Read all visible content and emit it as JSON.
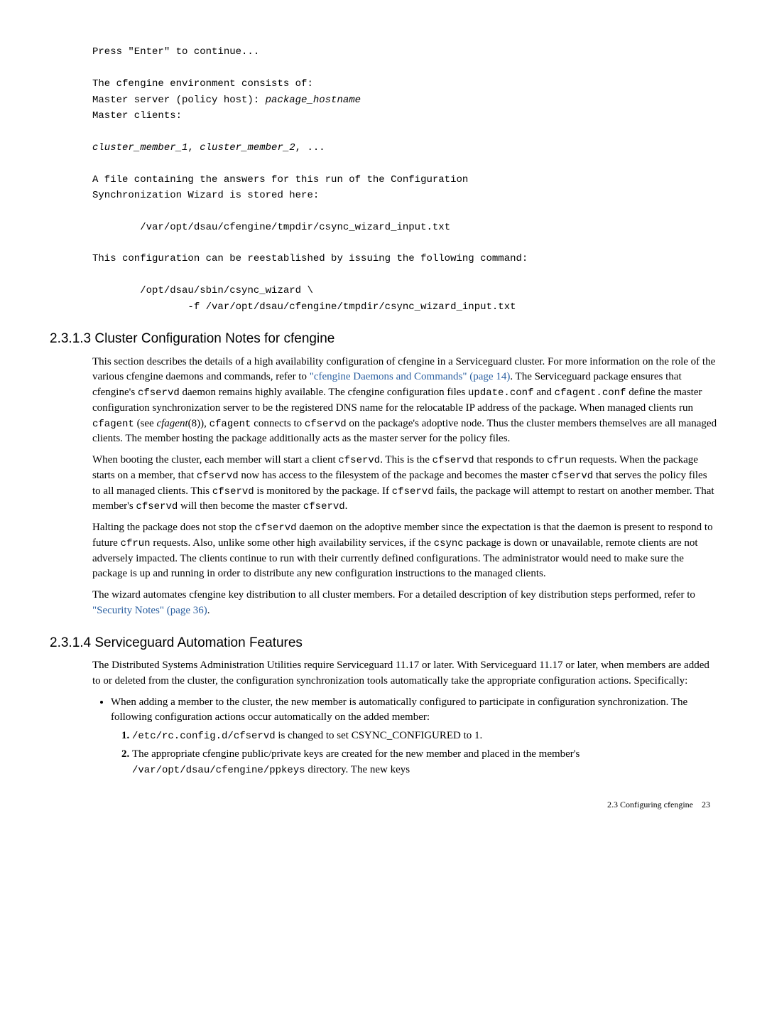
{
  "code": {
    "line1": "Press \"Enter\" to continue...",
    "line2": "The cfengine environment consists of:",
    "line3a": "Master server (policy host): ",
    "line3b": "package_hostname",
    "line4": "Master clients:",
    "line5a": "cluster_member_1",
    "line5comma1": ", ",
    "line5b": "cluster_member_2",
    "line5comma2": ", ...",
    "line6": "A file containing the answers for this run of the Configuration",
    "line7": "Synchronization Wizard is stored here:",
    "line8": "        /var/opt/dsau/cfengine/tmpdir/csync_wizard_input.txt",
    "line9": "This configuration can be reestablished by issuing the following command:",
    "line10": "        /opt/dsau/sbin/csync_wizard \\",
    "line11": "                -f /var/opt/dsau/cfengine/tmpdir/csync_wizard_input.txt"
  },
  "section1": {
    "heading": "2.3.1.3 Cluster Configuration Notes for cfengine",
    "p1a": "This section describes the details of a high availability configuration of cfengine in a Serviceguard cluster. For more information on the role of the various cfengine daemons and commands, refer to ",
    "p1link": "\"cfengine Daemons and Commands\" (page 14)",
    "p1b": ". The Serviceguard package ensures that cfengine's ",
    "p1c": "cfservd",
    "p1d": " daemon remains highly available. The cfengine configuration files ",
    "p1e": "update.conf",
    "p1f": " and ",
    "p1g": "cfagent.conf",
    "p1h": " define the master configuration synchronization server to be the registered DNS name for the relocatable IP address of the package. When managed clients run ",
    "p1i": "cfagent",
    "p1j": " (see ",
    "p1k": "cfagent",
    "p1l": "(8)), ",
    "p1m": "cfagent",
    "p1n": " connects to ",
    "p1o": "cfservd",
    "p1p": " on the package's adoptive node. Thus the cluster members themselves are all managed clients. The member hosting the package additionally acts as the master server for the policy files.",
    "p2a": "When booting the cluster, each member will start a client ",
    "p2b": "cfservd",
    "p2c": ". This is the ",
    "p2d": "cfservd",
    "p2e": " that responds to ",
    "p2f": "cfrun",
    "p2g": " requests. When the package starts on a member, that ",
    "p2h": "cfservd",
    "p2i": " now has access to the filesystem of the package and becomes the master ",
    "p2j": "cfservd",
    "p2k": " that serves the policy files to all managed clients. This ",
    "p2l": "cfservd",
    "p2m": " is monitored by the package. If ",
    "p2n": "cfservd",
    "p2o": " fails, the package will attempt to restart on another member. That member's ",
    "p2p": "cfservd",
    "p2q": " will then become the master ",
    "p2r": "cfservd",
    "p2s": ".",
    "p3a": "Halting the package does not stop the ",
    "p3b": "cfservd",
    "p3c": " daemon on the adoptive member since the expectation is that the daemon is present to respond to future ",
    "p3d": "cfrun",
    "p3e": " requests. Also, unlike some other  high availability services, if the ",
    "p3f": "csync",
    "p3g": " package is down or unavailable, remote clients are not adversely impacted. The clients continue to run with their currently defined configurations. The administrator would need to make sure the package is up and running in order to distribute any new configuration instructions to the managed clients.",
    "p4a": "The wizard automates cfengine key distribution to all cluster members. For a detailed description of key distribution steps performed, refer to ",
    "p4link": "\"Security Notes\" (page 36)",
    "p4b": "."
  },
  "section2": {
    "heading": "2.3.1.4 Serviceguard Automation Features",
    "p1": "The Distributed Systems Administration Utilities require Serviceguard 11.17 or later. With Serviceguard 11.17 or later, when members are added to or deleted from the cluster, the configuration synchronization tools automatically take the appropriate configuration actions. Specifically:",
    "b1": "When adding a member to the cluster, the new member is automatically configured to participate in configuration synchronization. The following configuration actions occur automatically on the added member:",
    "n1a": "/etc/rc.config.d/cfservd",
    "n1b": " is changed to set CSYNC_CONFIGURED to 1.",
    "n2a": "The appropriate cfengine public/private keys are created for the new member and placed in the member's ",
    "n2b": "/var/opt/dsau/cfengine/ppkeys",
    "n2c": " directory. The new keys"
  },
  "footer": {
    "left": "2.3 Configuring cfengine",
    "right": "23"
  }
}
